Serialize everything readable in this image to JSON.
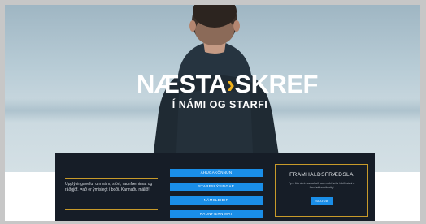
{
  "logo": {
    "main_left": "NÆSTA",
    "main_chevron": "›",
    "main_right": "SKREF",
    "subtitle": "Í NÁMI OG STARFI"
  },
  "intro": {
    "text": "Upplýsingavefur um nám, störf, raunfærnimat og ráðgjöf. Það er ýmislegt í boði. Kannaðu málið!"
  },
  "nav_buttons": [
    "Áhugakönnun",
    "Starfslýsingar",
    "Námsleiðir",
    "Raunfærnimat"
  ],
  "card": {
    "title": "FRAMHALDSFRÆÐSLA",
    "text": "Fyrir fólk á vinnumarkaði sem ekki hefur lokið námi á framhaldsskólastigi",
    "button": "SKOÐA"
  },
  "colors": {
    "accent_blue": "#1a8ee8",
    "accent_gold": "#c79a2a",
    "logo_chevron": "#f2b21c",
    "panel_bg": "#161d27"
  }
}
